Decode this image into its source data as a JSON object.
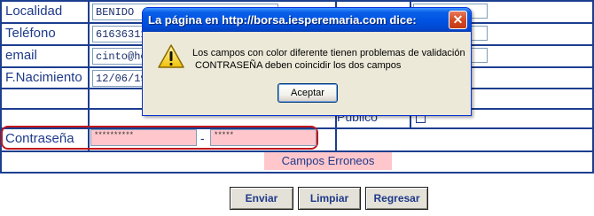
{
  "form": {
    "rows": [
      {
        "label": "Localidad",
        "value": "BENIDO"
      },
      {
        "label": "Teléfono",
        "value": "61636311"
      },
      {
        "label": "email",
        "value": "cinto@hc"
      },
      {
        "label": "F.Nacimiento",
        "value": "12/06/198"
      }
    ],
    "publico_label": "Público",
    "password": {
      "label": "Contraseña",
      "value1": "**********",
      "separator": "-",
      "value2": "*****"
    },
    "error_text": "Campos Erroneos",
    "buttons": {
      "submit": "Enviar",
      "clear": "Limpiar",
      "back": "Regresar"
    }
  },
  "dialog": {
    "title": "La página en http://borsa.iesperemaria.com dice:",
    "close_glyph": "✕",
    "icon": "warning-icon",
    "message_line1": "Los campos con color diferente tienen problemas de validación",
    "message_line2": " CONTRASEÑA deben coincidir los dos campos",
    "ok_label": "Aceptar"
  },
  "colors": {
    "form_text": "#1e3a8a",
    "error_bg": "#ffc7cc",
    "outline_red": "#c0171b",
    "title_blue": "#0054e3"
  }
}
